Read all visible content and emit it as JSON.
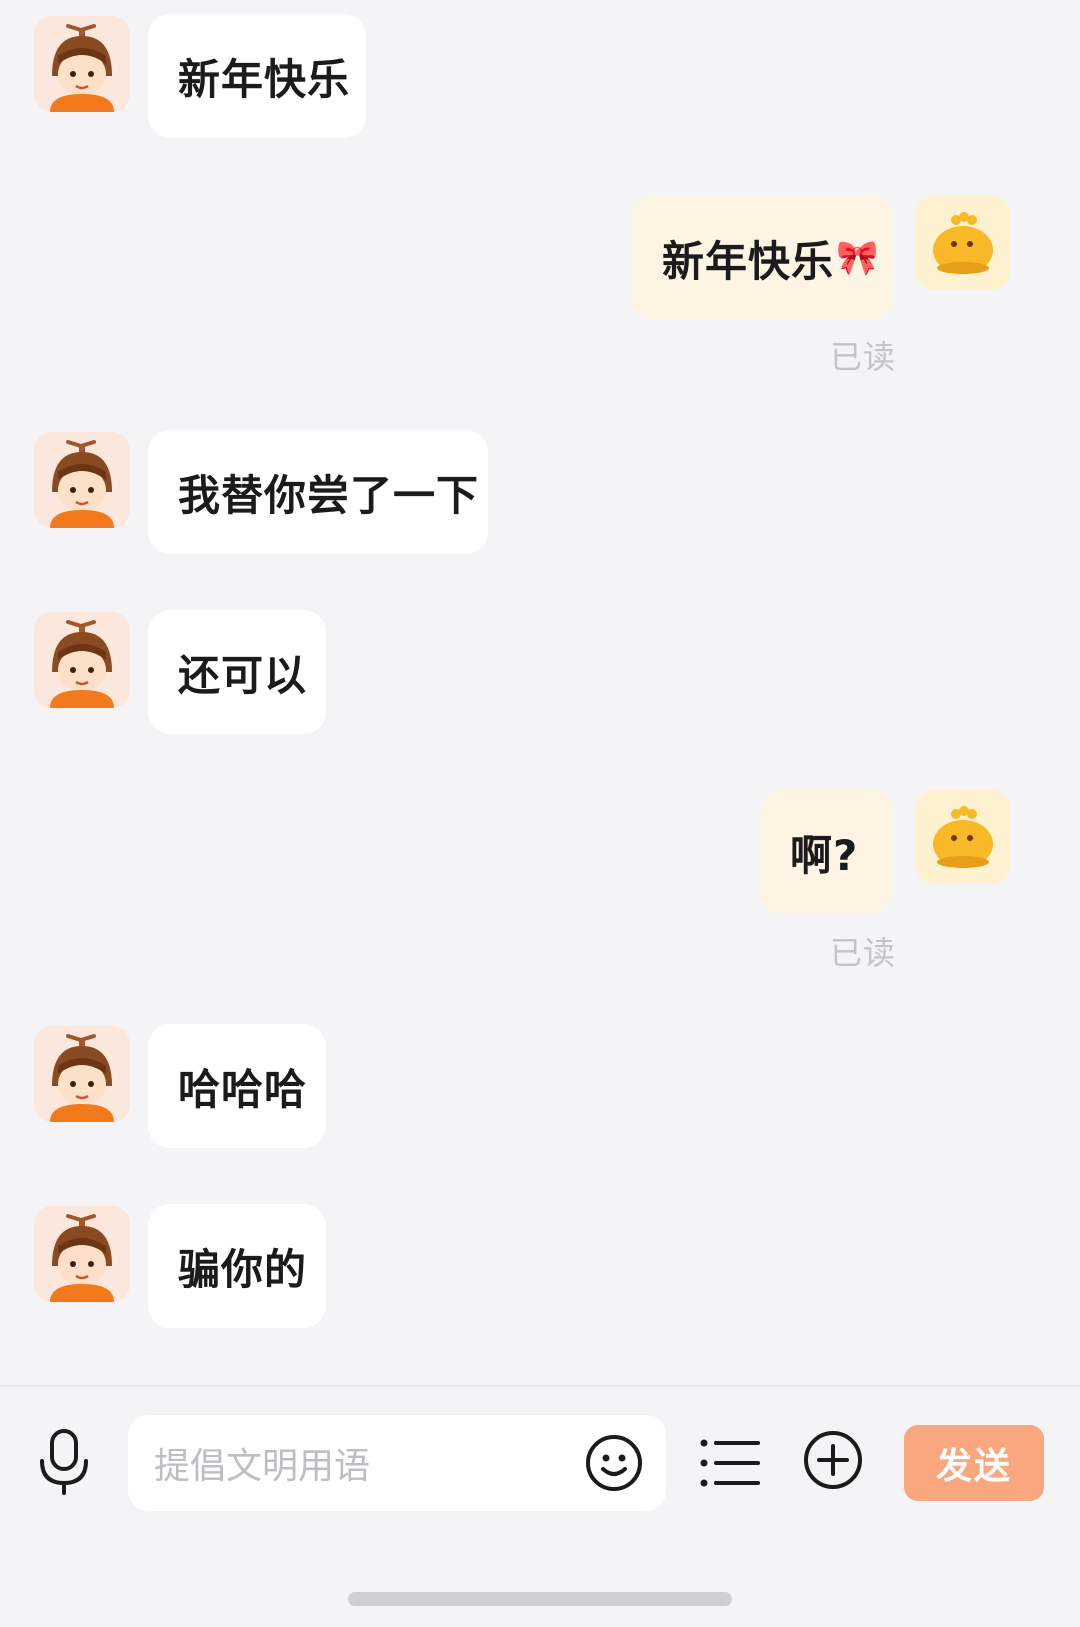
{
  "messages": [
    {
      "side": "in",
      "text": "新年快乐"
    },
    {
      "side": "out",
      "text": "新年快乐",
      "emoji": "🎀",
      "read_label": "已读"
    },
    {
      "side": "in",
      "text": "我替你尝了一下"
    },
    {
      "side": "in",
      "text": "还可以"
    },
    {
      "side": "out",
      "text": "啊?",
      "read_label": "已读"
    },
    {
      "side": "in",
      "text": "哈哈哈"
    },
    {
      "side": "in",
      "text": "骗你的"
    }
  ],
  "composer": {
    "placeholder": "提倡文明用语",
    "send_label": "发送"
  },
  "icons": {
    "voice": "microphone-icon",
    "emoji": "smiley-icon",
    "menu": "list-icon",
    "more": "plus-circle-icon",
    "bot_avatar": "helmet-kid-avatar",
    "self_avatar": "yellow-chick-avatar"
  },
  "colors": {
    "background": "#f4f4f6",
    "incoming_bubble": "#ffffff",
    "outgoing_bubble": "#fdf4e3",
    "send_button": "#f8a77e",
    "read_label": "#c3c3c8"
  }
}
